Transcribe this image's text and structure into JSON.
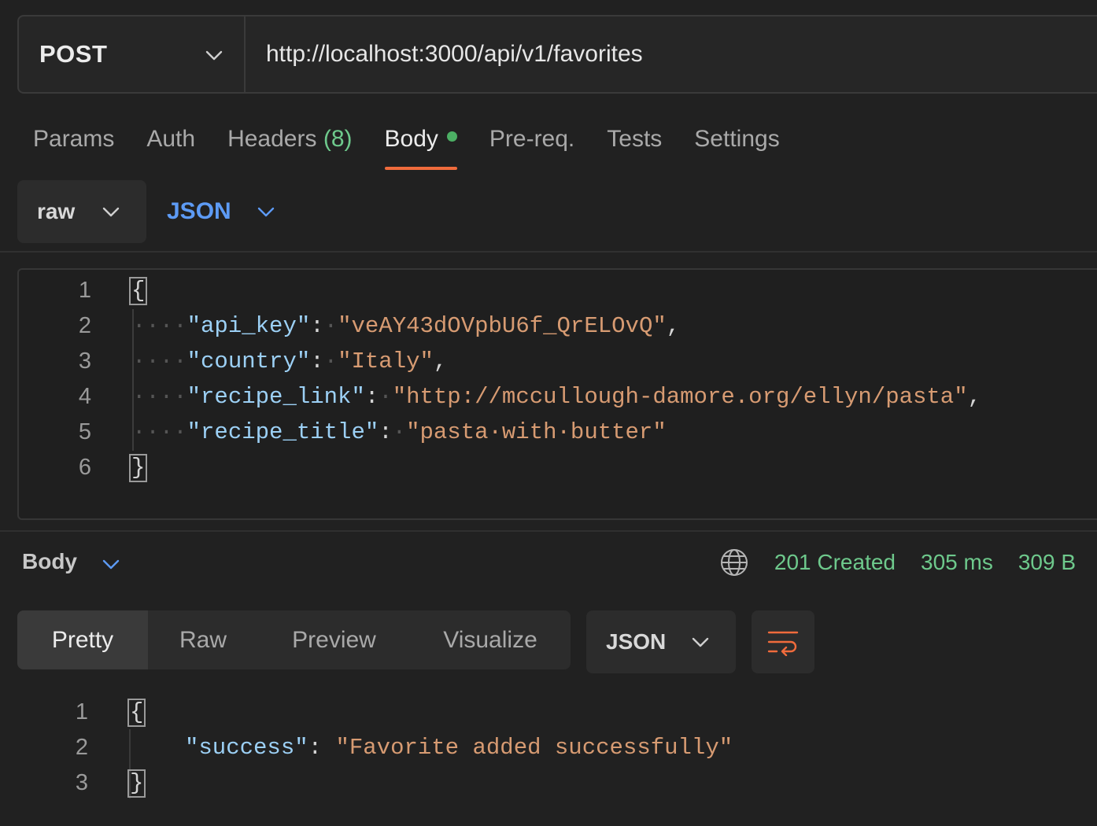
{
  "request": {
    "method": "POST",
    "url": "http://localhost:3000/api/v1/favorites"
  },
  "tabs": [
    {
      "label": "Params"
    },
    {
      "label": "Auth"
    },
    {
      "label": "Headers",
      "count": "(8)"
    },
    {
      "label": "Body",
      "active": true,
      "indicator": "green-dot"
    },
    {
      "label": "Pre-req."
    },
    {
      "label": "Tests"
    },
    {
      "label": "Settings"
    }
  ],
  "body_mode": "raw",
  "body_format": "JSON",
  "request_body": {
    "line_numbers": [
      "1",
      "2",
      "3",
      "4",
      "5",
      "6"
    ],
    "open_brace": "{",
    "close_brace": "}",
    "entries": [
      {
        "key": "\"api_key\"",
        "value": "\"veAY43dOVpbU6f_QrELOvQ\"",
        "trail": ","
      },
      {
        "key": "\"country\"",
        "value": "\"Italy\"",
        "trail": ","
      },
      {
        "key": "\"recipe_link\"",
        "value": "\"http://mccullough-damore.org/ellyn/pasta\"",
        "trail": ","
      },
      {
        "key": "\"recipe_title\"",
        "value": "\"pasta·with·butter\"",
        "trail": ""
      }
    ]
  },
  "response": {
    "section_label": "Body",
    "status": "201 Created",
    "time": "305 ms",
    "size": "309 B",
    "view_tabs": [
      "Pretty",
      "Raw",
      "Preview",
      "Visualize"
    ],
    "active_view": "Pretty",
    "format": "JSON",
    "line_numbers": [
      "1",
      "2",
      "3"
    ],
    "open_brace": "{",
    "close_brace": "}",
    "entry": {
      "key": "\"success\"",
      "value": "\"Favorite added successfully\""
    }
  },
  "colors": {
    "accent": "#f06b3c",
    "success": "#6ec98c",
    "link_blue": "#5d9bf5",
    "json_key": "#9cd0f5",
    "json_string": "#d79b72"
  },
  "icons": [
    "chevron-down-icon",
    "globe-icon",
    "wrap-lines-icon"
  ]
}
